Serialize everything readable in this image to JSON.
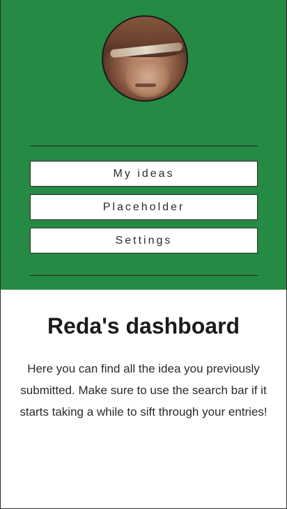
{
  "nav": {
    "avatar_alt": "Profile photo",
    "items": [
      {
        "label": "My ideas"
      },
      {
        "label": "Placeholder"
      },
      {
        "label": "Settings"
      }
    ]
  },
  "main": {
    "title": "Reda's dashboard",
    "description": "Here you can find all the idea you previously submitted. Make sure to use the search bar if it starts taking a while to sift through your entries!"
  },
  "colors": {
    "panel_green": "#258a44",
    "button_bg": "#ffffff",
    "text_dark": "#1b1b1b"
  }
}
